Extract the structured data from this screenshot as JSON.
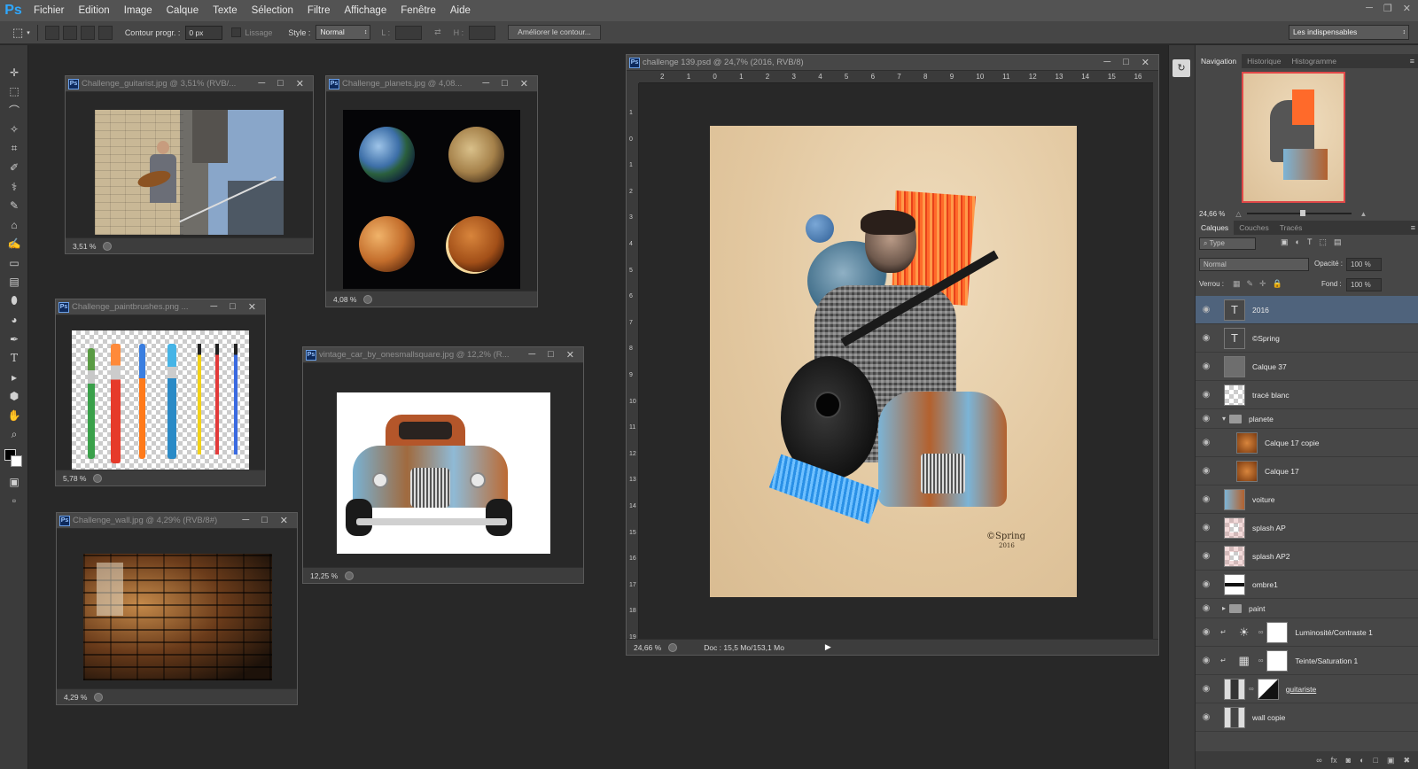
{
  "app": {
    "logo": "Ps"
  },
  "menu": [
    "Fichier",
    "Edition",
    "Image",
    "Calque",
    "Texte",
    "Sélection",
    "Filtre",
    "Affichage",
    "Fenêtre",
    "Aide"
  ],
  "options": {
    "contour_label": "Contour progr. :",
    "contour_value": "0 px",
    "lissage": "Lissage",
    "style_label": "Style :",
    "style_value": "Normal",
    "l_label": "L :",
    "h_label": "H :",
    "refine_button": "Améliorer le contour...",
    "workspace": "Les indispensables"
  },
  "documents": [
    {
      "title": "Challenge_guitarist.jpg @ 3,51% (RVB/...",
      "zoom": "3,51 %"
    },
    {
      "title": "Challenge_planets.jpg @ 4,08...",
      "zoom": "4,08 %"
    },
    {
      "title": "Challenge_paintbrushes.png ...",
      "zoom": "5,78 %"
    },
    {
      "title": "vintage_car_by_onesmallsquare.jpg @ 12,2% (R...",
      "zoom": "12,25 %"
    },
    {
      "title": "Challenge_wall.jpg @ 4,29% (RVB/8#)",
      "zoom": "4,29 %"
    },
    {
      "title": "challenge 139.psd @ 24,7% (2016, RVB/8)",
      "zoom": "24,66 %",
      "doc_info": "Doc : 15,5 Mo/153,1 Mo"
    }
  ],
  "ruler_h": [
    "2",
    "1",
    "0",
    "1",
    "2",
    "3",
    "4",
    "5",
    "6",
    "7",
    "8",
    "9",
    "10",
    "11",
    "12",
    "13",
    "14",
    "15",
    "16"
  ],
  "ruler_v": [
    "1",
    "0",
    "1",
    "2",
    "3",
    "4",
    "5",
    "6",
    "7",
    "8",
    "9",
    "10",
    "11",
    "12",
    "13",
    "14",
    "15",
    "16",
    "17",
    "18",
    "19"
  ],
  "signature": "©Spring",
  "signature_year": "2016",
  "navigation": {
    "tabs": [
      "Navigation",
      "Historique",
      "Histogramme"
    ],
    "zoom": "24,66 %"
  },
  "layers_panel": {
    "tabs": [
      "Calques",
      "Couches",
      "Tracés"
    ],
    "filter": "Type",
    "blend_mode": "Normal",
    "opacity_label": "Opacité :",
    "opacity": "100 %",
    "lock_label": "Verrou :",
    "fill_label": "Fond :",
    "fill": "100 %",
    "layers": [
      {
        "name": "2016",
        "kind": "text"
      },
      {
        "name": "©Spring",
        "kind": "text"
      },
      {
        "name": "Calque 37",
        "kind": "gray"
      },
      {
        "name": "tracé blanc",
        "kind": "checker"
      },
      {
        "name": "planete",
        "kind": "group-open"
      },
      {
        "name": "Calque 17 copie",
        "kind": "planet"
      },
      {
        "name": "Calque 17",
        "kind": "planet"
      },
      {
        "name": "voiture",
        "kind": "car"
      },
      {
        "name": "splash AP",
        "kind": "splash"
      },
      {
        "name": "splash AP2",
        "kind": "splash"
      },
      {
        "name": "ombre1",
        "kind": "shadow"
      },
      {
        "name": "paint",
        "kind": "group-closed"
      },
      {
        "name": "Luminosité/Contraste 1",
        "kind": "adjust"
      },
      {
        "name": "Teinte/Saturation 1",
        "kind": "adjust2"
      },
      {
        "name": "guitariste",
        "kind": "photo"
      },
      {
        "name": "wall copie",
        "kind": "wall"
      }
    ]
  }
}
